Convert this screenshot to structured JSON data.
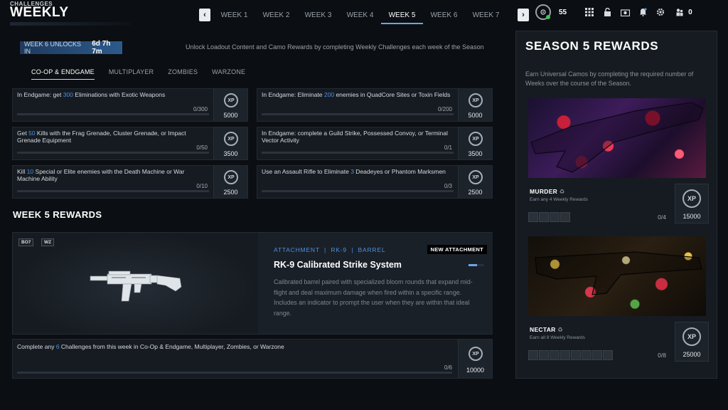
{
  "header": {
    "breadcrumb": "CHALLENGES",
    "title": "WEEKLY",
    "prev_icon": "‹",
    "next_icon": "›",
    "weeks": [
      "WEEK 1",
      "WEEK 2",
      "WEEK 3",
      "WEEK 4",
      "WEEK 5",
      "WEEK 6",
      "WEEK 7"
    ],
    "active_week": "WEEK 5",
    "player_level": "55",
    "friends_count": "0"
  },
  "unlock": {
    "label": "WEEK 6 UNLOCKS IN",
    "time": "6d 7h 7m",
    "description": "Unlock Loadout Content and Camo Rewards by completing Weekly Challenges each week of the Season"
  },
  "modes": [
    "CO-OP & ENDGAME",
    "MULTIPLAYER",
    "ZOMBIES",
    "WARZONE"
  ],
  "challenges": [
    {
      "pre": "In Endgame: get ",
      "num": "300",
      "post": " Eliminations with Exotic Weapons",
      "progress": "0/300",
      "xp": "5000"
    },
    {
      "pre": "In Endgame: Eliminate ",
      "num": "200",
      "post": " enemies in QuadCore Sites or Toxin Fields",
      "progress": "0/200",
      "xp": "5000"
    },
    {
      "pre": "Get ",
      "num": "50",
      "post": " Kills with the Frag Grenade, Cluster Grenade, or Impact Grenade Equipment",
      "progress": "0/50",
      "xp": "3500"
    },
    {
      "pre": "In Endgame: complete a Guild Strike, Possessed Convoy, or Terminal Vector Activity",
      "num": "",
      "post": "",
      "progress": "0/1",
      "xp": "3500"
    },
    {
      "pre": "Kill ",
      "num": "10",
      "post": " Special or Elite enemies with the Death Machine or War Machine Ability",
      "progress": "0/10",
      "xp": "2500"
    },
    {
      "pre": "Use an Assault Rifle to Eliminate ",
      "num": "3",
      "post": " Deadeyes or Phantom Marksmen",
      "progress": "0/3",
      "xp": "2500"
    }
  ],
  "week_rewards": {
    "title": "WEEK 5 REWARDS",
    "tag_bo7": "BO7",
    "tag_wz": "WZ",
    "type_line": "ATTACHMENT  |  RK-9  |  BARREL",
    "badge": "NEW ATTACHMENT",
    "name": "RK-9 Calibrated Strike System",
    "description": "Calibrated barrel paired with specialized bloom rounds that expand mid-flight and deal maximum damage when fired within a specific range. Includes an indicator to prompt the user when they are within that ideal range.",
    "challenge": {
      "pre": "Complete any ",
      "num": "6",
      "post": " Challenges from this week in Co-Op & Endgame, Multiplayer, Zombies, or Warzone",
      "progress": "0/6",
      "xp": "10000"
    }
  },
  "season": {
    "title": "SEASON 5 REWARDS",
    "description": "Earn Universal Camos by completing the required number of Weeks over the course of the Season.",
    "camos": [
      {
        "name": "MURDER",
        "sub": "Earn any 4 Weekly Rewards",
        "progress": "0/4",
        "xp": "15000",
        "slots": 4
      },
      {
        "name": "NECTAR",
        "sub": "Earn all 8 Weekly Rewards",
        "progress": "0/8",
        "xp": "25000",
        "slots": 8
      }
    ]
  },
  "xp_label": "XP"
}
